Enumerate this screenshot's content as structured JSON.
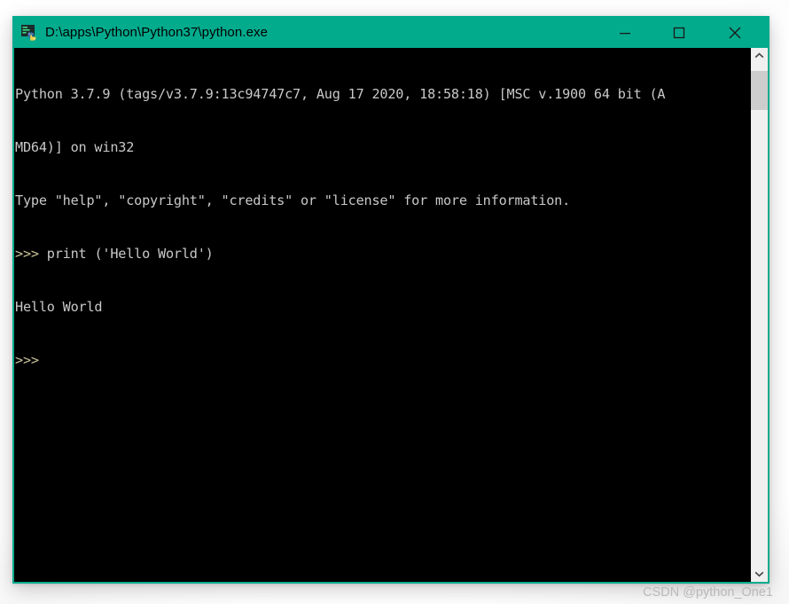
{
  "window": {
    "title": "D:\\apps\\Python\\Python37\\python.exe",
    "icon": "python-console-icon",
    "accent_color": "#03ab8d",
    "controls": {
      "minimize_label": "Minimize",
      "maximize_label": "Maximize",
      "close_label": "Close"
    }
  },
  "console": {
    "background_color": "#000000",
    "text_color": "#c8c8c8",
    "prompt_color": "#c9c39a",
    "lines": [
      {
        "type": "output",
        "text": "Python 3.7.9 (tags/v3.7.9:13c94747c7, Aug 17 2020, 18:58:18) [MSC v.1900 64 bit (A"
      },
      {
        "type": "output",
        "text": "MD64)] on win32"
      },
      {
        "type": "output",
        "text": "Type \"help\", \"copyright\", \"credits\" or \"license\" for more information."
      },
      {
        "type": "input",
        "prompt": ">>>",
        "text": " print ('Hello World')"
      },
      {
        "type": "output",
        "text": "Hello World"
      },
      {
        "type": "input",
        "prompt": ">>>",
        "text": ""
      }
    ]
  },
  "scrollbar": {
    "up_arrow": "chevron-up-icon",
    "down_arrow": "chevron-down-icon",
    "track_color": "#f0f0f0",
    "thumb_color": "#cdcdcd"
  },
  "watermark": {
    "text": "CSDN @python_One1"
  }
}
